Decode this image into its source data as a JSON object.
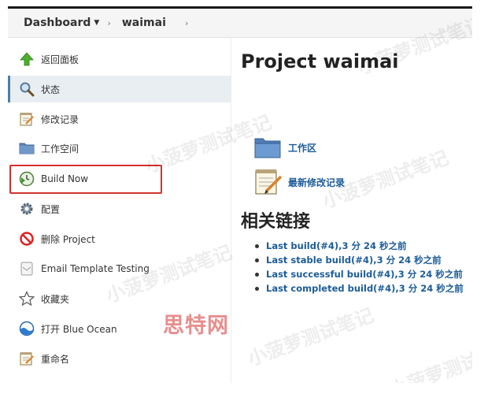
{
  "breadcrumb": {
    "dashboard": "Dashboard",
    "project": "waimai"
  },
  "sidebar": {
    "items": [
      {
        "label": "返回面板",
        "icon": "up-arrow-icon"
      },
      {
        "label": "状态",
        "icon": "magnifier-icon"
      },
      {
        "label": "修改记录",
        "icon": "notepad-icon"
      },
      {
        "label": "工作空间",
        "icon": "folder-icon"
      },
      {
        "label": "Build Now",
        "icon": "clock-play-icon"
      },
      {
        "label": "配置",
        "icon": "gear-icon"
      },
      {
        "label": "删除 Project",
        "icon": "no-entry-icon"
      },
      {
        "label": "Email Template Testing",
        "icon": "envelope-icon"
      },
      {
        "label": "收藏夹",
        "icon": "star-icon"
      },
      {
        "label": "打开 Blue Ocean",
        "icon": "blue-ocean-icon"
      },
      {
        "label": "重命名",
        "icon": "notepad-icon"
      }
    ]
  },
  "main": {
    "title": "Project waimai",
    "workspace_link": "工作区",
    "changes_link": "最新修改记录",
    "related_heading": "相关链接",
    "related_links": [
      "Last build(#4),3 分 24 秒之前",
      "Last stable build(#4),3 分 24 秒之前",
      "Last successful build(#4),3 分 24 秒之前",
      "Last completed build(#4),3 分 24 秒之前"
    ]
  },
  "watermark": {
    "text": "小菠萝测试笔记",
    "brand": "思特网"
  },
  "colors": {
    "link": "#1c5c99",
    "highlight_border": "#d0312d",
    "active_bg": "#e9eef2"
  }
}
